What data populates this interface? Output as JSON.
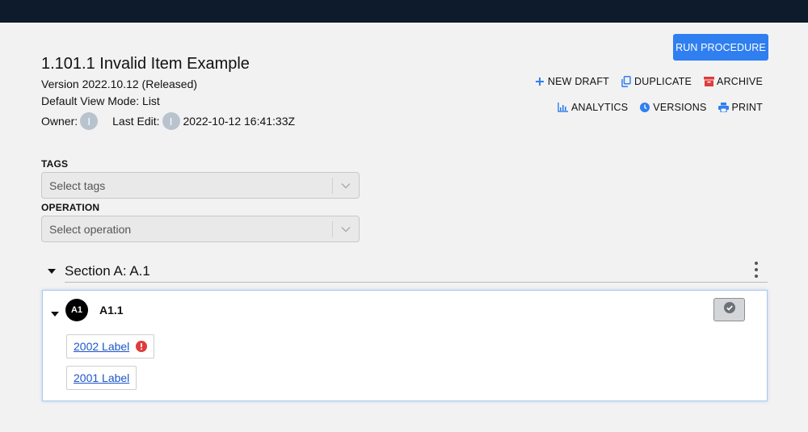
{
  "header": {
    "title": "1.101.1 Invalid Item Example",
    "version": "Version 2022.10.12 (Released)",
    "view_mode": "Default View Mode: List",
    "owner_label": "Owner:",
    "owner_initial": "I",
    "last_edit_label": "Last Edit:",
    "last_edit_initial": "I",
    "last_edit_time": "2022-10-12 16:41:33Z"
  },
  "toolbar": {
    "run_label": "RUN PROCEDURE",
    "new_draft": "NEW DRAFT",
    "duplicate": "DUPLICATE",
    "archive": "ARCHIVE",
    "analytics": "ANALYTICS",
    "versions": "VERSIONS",
    "print": "PRINT"
  },
  "filters": {
    "tags_label": "TAGS",
    "tags_placeholder": "Select tags",
    "operation_label": "OPERATION",
    "operation_placeholder": "Select operation"
  },
  "section": {
    "title": "Section A: A.1",
    "step": {
      "badge": "A1",
      "title": "A1.1",
      "items": [
        {
          "label": "2002 Label",
          "has_error": true
        },
        {
          "label": "2001 Label",
          "has_error": false
        }
      ]
    }
  },
  "colors": {
    "accent": "#2f7ff0",
    "archive": "#e03b3b",
    "error": "#e03b3b",
    "topbar": "#0e1b2c"
  },
  "icons": {
    "new_draft": "plus-icon",
    "duplicate": "copy-icon",
    "archive": "archive-box-icon",
    "analytics": "bar-chart-icon",
    "versions": "clock-icon",
    "print": "printer-icon"
  }
}
